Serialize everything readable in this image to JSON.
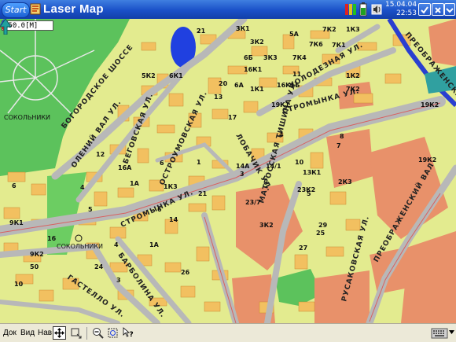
{
  "titlebar": {
    "start_label": "Start",
    "app_title": "Laser Map",
    "date": "15.04.04",
    "time": "22:53",
    "icons": [
      "app-icon",
      "signal-icon",
      "battery-icon",
      "speaker-icon",
      "ok-icon",
      "close-icon",
      "menu-icon"
    ]
  },
  "map": {
    "coord_field_value": "150.0[M]",
    "place_labels": [
      "СОКОЛЬНИКИ",
      "СОКОЛЬНИКИ"
    ],
    "street_labels": [
      "БОГОРОДСКОЕ ШОССЕ",
      "ОЛЕНИЙ ВАЛ УЛ.",
      "ОСТРОУМОВСКАЯ УЛ.",
      "БЕГОВСКАЯ УЛ.",
      "СТРОМЫНКА УЛ.",
      "СТРОМЫНКА УЛ.",
      "ХОЛОДЕЗНАЯ УЛ.",
      "ЛОБАЧИК УЛ.",
      "МАТРОССКАЯ ТИШИНА УЛ.",
      "ГАСТЕЛЛО УЛ.",
      "БАРБОЛИНА УЛ.",
      "ПРЕОБРАЖЕНСКИЙ ВАЛ",
      "ПРЕОБРАЖЕНСКАЯ ПЛ.",
      "РУСАКОВСКАЯ УЛ."
    ],
    "building_labels": [
      "21",
      "3К1",
      "3К2",
      "5А",
      "7К2",
      "1К3",
      "7К6",
      "7К1",
      "6Б",
      "3К3",
      "7К4",
      "5К2",
      "6К1",
      "16К1",
      "6А",
      "1К1",
      "16К1Б",
      "11",
      "1К2",
      "7К2",
      "19К2",
      "19К1",
      "20",
      "13",
      "12",
      "17",
      "1",
      "3",
      "4",
      "7",
      "8",
      "10",
      "14/1",
      "23К2",
      "13К1",
      "23/7",
      "3К2",
      "5",
      "2К3",
      "19К2",
      "6",
      "16А",
      "1А",
      "1К3",
      "4",
      "5",
      "6",
      "9К1",
      "9К2",
      "50",
      "10",
      "16",
      "29",
      "25",
      "27",
      "14",
      "1А",
      "14А",
      "21",
      "4",
      "3",
      "6",
      "24",
      "26",
      "2",
      "3"
    ]
  },
  "bottombar": {
    "menu_doc": "Док",
    "menu_view": "Вид",
    "menu_nav": "Нав",
    "tools": [
      "pan-tool",
      "select-tool",
      "zoom-out-tool",
      "zoom-extent-tool",
      "help-tool"
    ]
  },
  "colors": {
    "titlebar": "#1a50c8",
    "park": "#5cc25c",
    "block": "#f5ee77",
    "building_residential": "#f2c060",
    "building_industrial": "#e8916a",
    "road": "#b8b8b8",
    "metro_line": "#2a3fd0",
    "water": "#2040e0"
  }
}
